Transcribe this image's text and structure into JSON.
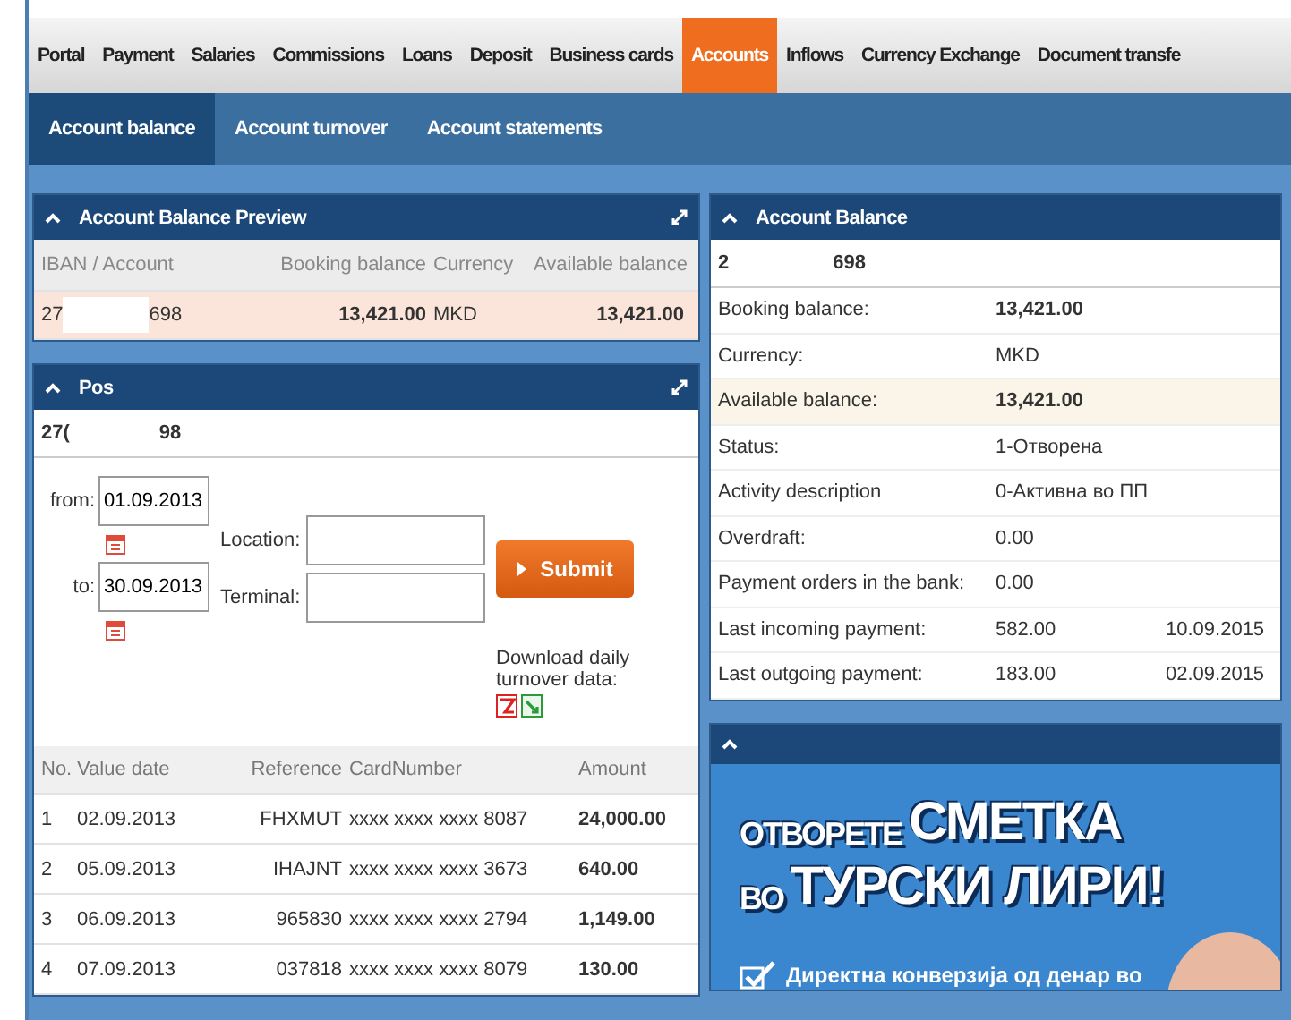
{
  "nav": {
    "tabs": [
      {
        "label": "Portal",
        "selected": false
      },
      {
        "label": "Payment",
        "selected": false
      },
      {
        "label": "Salaries",
        "selected": false
      },
      {
        "label": "Commissions",
        "selected": false
      },
      {
        "label": "Loans",
        "selected": false
      },
      {
        "label": "Deposit",
        "selected": false
      },
      {
        "label": "Business cards",
        "selected": false
      },
      {
        "label": "Accounts",
        "selected": true
      },
      {
        "label": "Inflows",
        "selected": false
      },
      {
        "label": "Currency Exchange",
        "selected": false
      },
      {
        "label": "Document transfe",
        "selected": false
      }
    ]
  },
  "subnav": {
    "tabs": [
      {
        "label": "Account balance",
        "selected": true
      },
      {
        "label": "Account turnover",
        "selected": false
      },
      {
        "label": "Account statements",
        "selected": false
      }
    ]
  },
  "preview_panel": {
    "title": "Account Balance Preview",
    "columns": [
      "IBAN / Account",
      "Booking balance",
      "Currency",
      "Available balance"
    ],
    "rows": [
      {
        "account_start": "27",
        "account_end": "698",
        "booking_balance": "13,421.00",
        "currency": "MKD",
        "available_balance": "13,421.00"
      }
    ]
  },
  "pos_panel": {
    "title": "Pos",
    "account_start": "27(",
    "account_end": "98",
    "from_label": "from:",
    "from_value": "01.09.2013",
    "to_label": "to:",
    "to_value": "30.09.2013",
    "location_label": "Location:",
    "terminal_label": "Terminal:",
    "submit": "Submit",
    "download_label": "Download daily turnover data:",
    "columns": [
      "No.",
      "Value date",
      "Reference",
      "CardNumber",
      "Amount"
    ],
    "rows": [
      [
        "1",
        "02.09.2013",
        "FHXMUT",
        "xxxx xxxx xxxx 8087",
        "24,000.00"
      ],
      [
        "2",
        "05.09.2013",
        "IHAJNT",
        "xxxx xxxx xxxx 3673",
        "640.00"
      ],
      [
        "3",
        "06.09.2013",
        "965830",
        "xxxx xxxx xxxx 2794",
        "1,149.00"
      ],
      [
        "4",
        "07.09.2013",
        "037818",
        "xxxx xxxx xxxx 8079",
        "130.00"
      ]
    ]
  },
  "balance_panel": {
    "title": "Account Balance",
    "account_start": "2",
    "account_end": "698",
    "rows": [
      {
        "label": "Booking balance:",
        "value": "13,421.00",
        "bold": true,
        "highlighted": false
      },
      {
        "label": "Currency:",
        "value": "MKD",
        "bold": false,
        "highlighted": false
      },
      {
        "label": "Available balance:",
        "value": "13,421.00",
        "bold": true,
        "highlighted": true
      },
      {
        "label": "Status:",
        "value": "1-Отворена",
        "bold": false,
        "highlighted": false
      },
      {
        "label": "Activity description",
        "value": "0-Активна во ПП",
        "bold": false,
        "highlighted": false
      },
      {
        "label": "Overdraft:",
        "value": "0.00",
        "bold": false,
        "highlighted": false
      },
      {
        "label": "Payment orders in the bank:",
        "value": "0.00",
        "bold": false,
        "highlighted": false
      },
      {
        "label": "Last incoming payment:",
        "value": "582.00",
        "date": "10.09.2015",
        "bold": false,
        "highlighted": false
      },
      {
        "label": "Last outgoing payment:",
        "value": "183.00",
        "date": "02.09.2015",
        "bold": false,
        "highlighted": false
      }
    ]
  },
  "banner_panel": {
    "headline": [
      [
        {
          "text": "ОТВОРЕТЕ",
          "kind": "small"
        },
        {
          "text": "СМЕТКА",
          "kind": "large"
        }
      ],
      [
        {
          "text": "ВО",
          "kind": "small"
        },
        {
          "text": "ТУРСКИ ЛИРИ!",
          "kind": "large"
        }
      ]
    ],
    "bullet": "Директна конверзија од денар во"
  }
}
